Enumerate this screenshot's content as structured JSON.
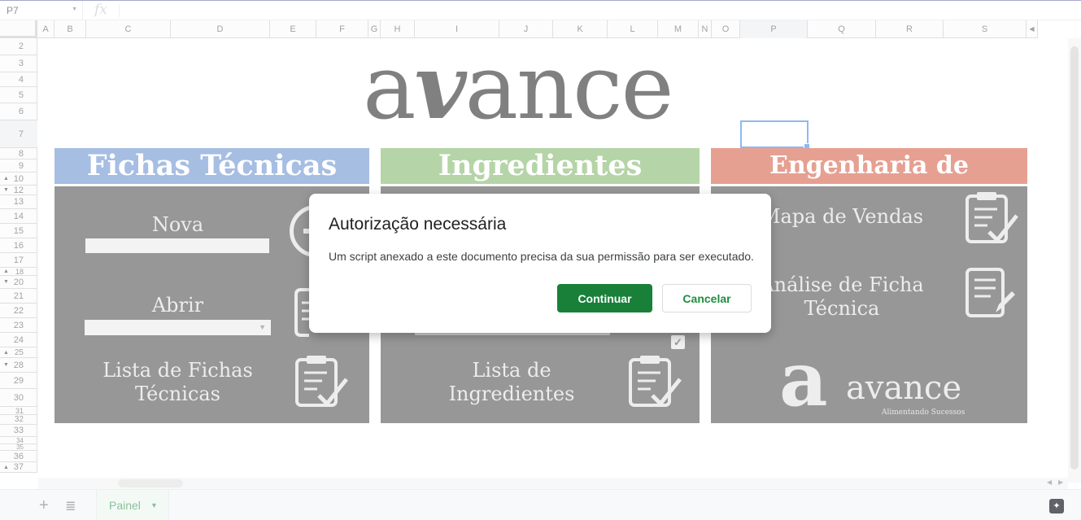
{
  "formula_bar": {
    "cell_ref": "P7",
    "fx_icon": "fx-icon"
  },
  "columns": [
    "A",
    "B",
    "C",
    "D",
    "E",
    "F",
    "G",
    "H",
    "I",
    "J",
    "K",
    "L",
    "M",
    "N",
    "O",
    "P",
    "Q",
    "R",
    "S"
  ],
  "rows": [
    "2",
    "3",
    "4",
    "5",
    "6",
    "7",
    "8",
    "9",
    "10",
    "12",
    "13",
    "14",
    "15",
    "16",
    "17",
    "18",
    "20",
    "21",
    "22",
    "23",
    "24",
    "25",
    "28",
    "29",
    "30",
    "31",
    "32",
    "33",
    "34",
    "35",
    "36",
    "37"
  ],
  "logo": {
    "left": "a",
    "v": "v",
    "right": "ance"
  },
  "panels": {
    "fichas": {
      "title": "Fichas Técnicas",
      "nova": "Nova",
      "abrir": "Abrir",
      "lista": "Lista de Fichas Técnicas",
      "color": "#4f7cc7"
    },
    "ingredientes": {
      "title": "Ingredientes",
      "lista": "Lista de Ingredientes",
      "color": "#6aa84f"
    },
    "engenharia": {
      "title": "Engenharia de Cardápio",
      "mapa": "Mapa de Vendas",
      "analise": "Análise de Ficha Técnica",
      "brand_a": "a",
      "brand_word": "avance",
      "brand_slogan": "Alimentando Sucessos",
      "color": "#cc4125"
    }
  },
  "dialog": {
    "title": "Autorização necessária",
    "message": "Um script anexado a este documento precisa da sua permissão para ser executado.",
    "continue_label": "Continuar",
    "cancel_label": "Cancelar",
    "continue_color": "#188038"
  },
  "sheet_bar": {
    "tab_name": "Painel",
    "add_icon": "plus-icon",
    "list_icon": "list-icon"
  }
}
